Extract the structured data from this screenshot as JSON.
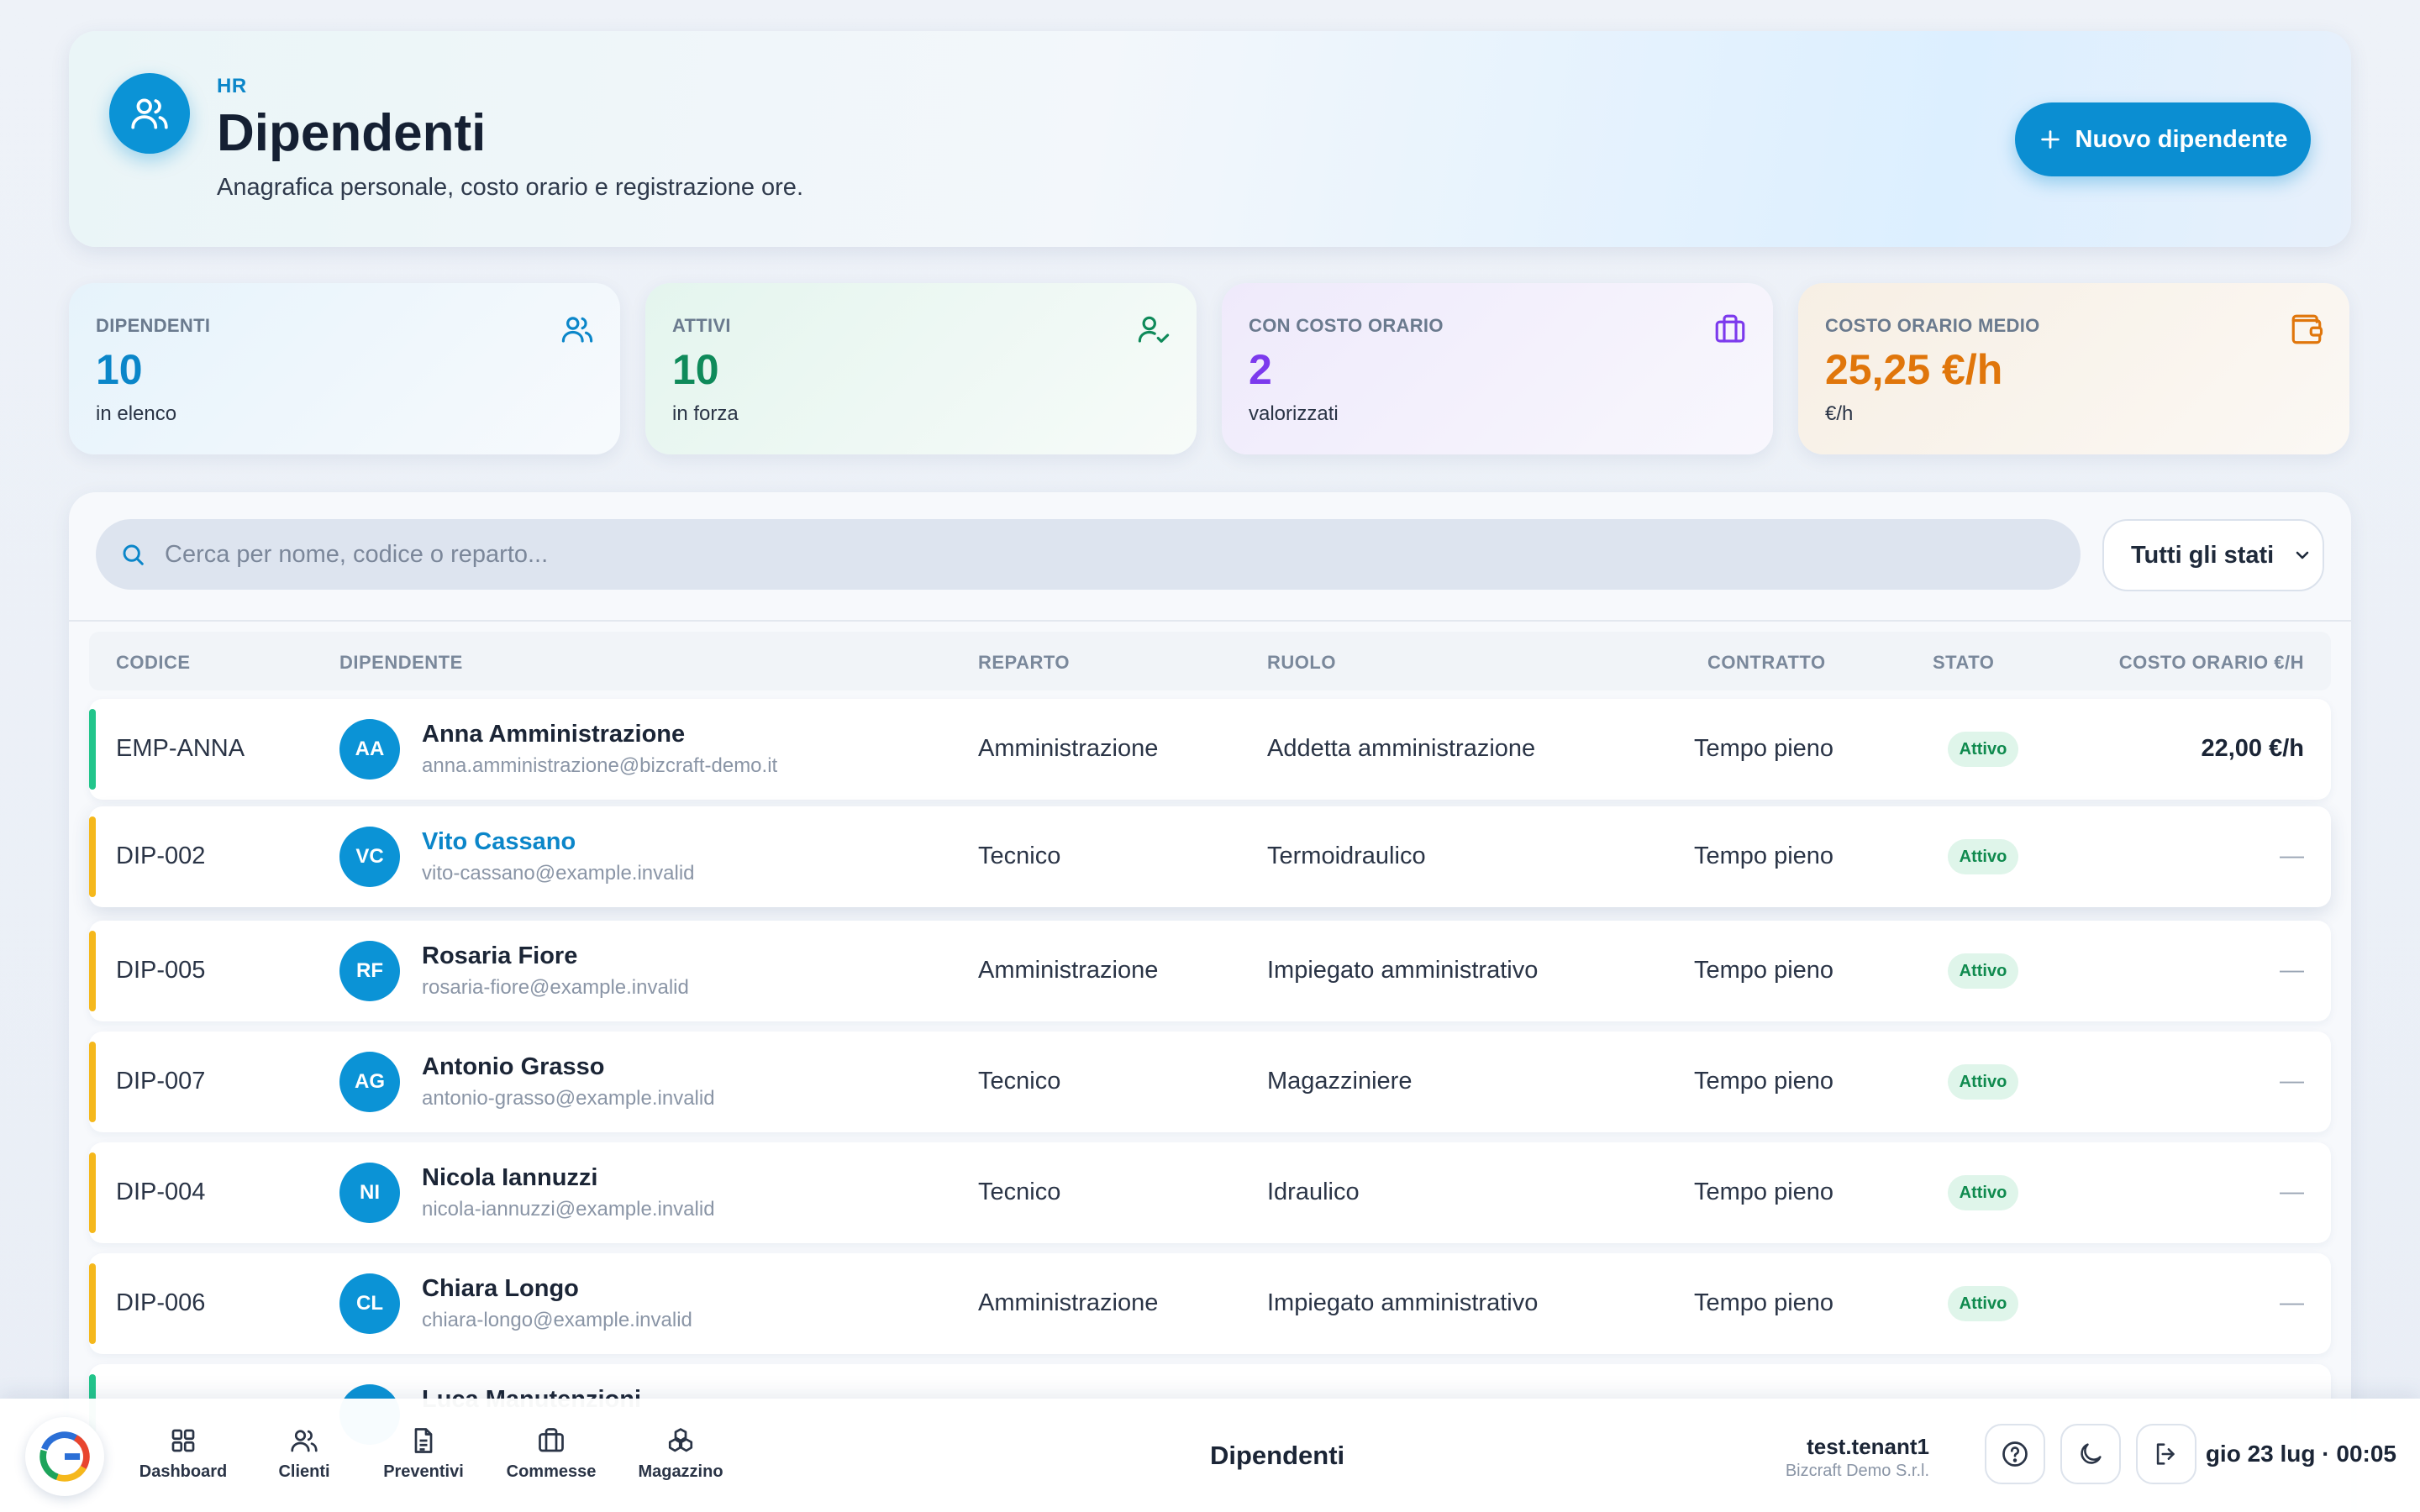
{
  "header": {
    "eyebrow": "HR",
    "title": "Dipendenti",
    "subtitle": "Anagrafica personale, costo orario e registrazione ore.",
    "new_button_label": "Nuovo dipendente"
  },
  "stats": [
    {
      "label": "DIPENDENTI",
      "value": "10",
      "sub": "in elenco",
      "color": "#0b86c9",
      "icon": "users-icon"
    },
    {
      "label": "ATTIVI",
      "value": "10",
      "sub": "in forza",
      "color": "#0f8a5a",
      "icon": "user-check-icon"
    },
    {
      "label": "CON COSTO ORARIO",
      "value": "2",
      "sub": "valorizzati",
      "color": "#7c3aed",
      "icon": "briefcase-icon"
    },
    {
      "label": "COSTO ORARIO MEDIO",
      "value": "25,25 €/h",
      "sub": "€/h",
      "color": "#e0760b",
      "icon": "wallet-icon"
    }
  ],
  "filters": {
    "search_placeholder": "Cerca per nome, codice o reparto...",
    "status_selected": "Tutti gli stati"
  },
  "table": {
    "columns": [
      "CODICE",
      "DIPENDENTE",
      "REPARTO",
      "RUOLO",
      "CONTRATTO",
      "STATO",
      "COSTO ORARIO €/H"
    ],
    "rows": [
      {
        "code": "EMP-ANNA",
        "initials": "AA",
        "name": "Anna Amministrazione",
        "email": "anna.amministrazione@bizcraft-demo.it",
        "department": "Amministrazione",
        "role": "Addetta amministrazione",
        "contract": "Tempo pieno",
        "status": "Attivo",
        "cost": "22,00 €/h",
        "accent": "#22c58b"
      },
      {
        "code": "DIP-002",
        "initials": "VC",
        "name": "Vito Cassano",
        "email": "vito-cassano@example.invalid",
        "department": "Tecnico",
        "role": "Termoidraulico",
        "contract": "Tempo pieno",
        "status": "Attivo",
        "cost": "—",
        "accent": "#f5b81c"
      },
      {
        "code": "DIP-005",
        "initials": "RF",
        "name": "Rosaria Fiore",
        "email": "rosaria-fiore@example.invalid",
        "department": "Amministrazione",
        "role": "Impiegato amministrativo",
        "contract": "Tempo pieno",
        "status": "Attivo",
        "cost": "—",
        "accent": "#f5b81c"
      },
      {
        "code": "DIP-007",
        "initials": "AG",
        "name": "Antonio Grasso",
        "email": "antonio-grasso@example.invalid",
        "department": "Tecnico",
        "role": "Magazziniere",
        "contract": "Tempo pieno",
        "status": "Attivo",
        "cost": "—",
        "accent": "#f5b81c"
      },
      {
        "code": "DIP-004",
        "initials": "NI",
        "name": "Nicola Iannuzzi",
        "email": "nicola-iannuzzi@example.invalid",
        "department": "Tecnico",
        "role": "Idraulico",
        "contract": "Tempo pieno",
        "status": "Attivo",
        "cost": "—",
        "accent": "#f5b81c"
      },
      {
        "code": "DIP-006",
        "initials": "CL",
        "name": "Chiara Longo",
        "email": "chiara-longo@example.invalid",
        "department": "Amministrazione",
        "role": "Impiegato amministrativo",
        "contract": "Tempo pieno",
        "status": "Attivo",
        "cost": "—",
        "accent": "#f5b81c"
      },
      {
        "code": "",
        "initials": "",
        "name": "Luca Manutenzioni",
        "email": "",
        "department": "",
        "role": "",
        "contract": "",
        "status": "",
        "cost": "",
        "accent": "#22c58b"
      }
    ]
  },
  "bottom_bar": {
    "nav": [
      {
        "label": "Dashboard",
        "icon": "dashboard-icon"
      },
      {
        "label": "Clienti",
        "icon": "users-icon"
      },
      {
        "label": "Preventivi",
        "icon": "document-icon"
      },
      {
        "label": "Commesse",
        "icon": "briefcase-icon"
      },
      {
        "label": "Magazzino",
        "icon": "boxes-icon"
      }
    ],
    "page_title": "Dipendenti",
    "user_name": "test.tenant1",
    "user_org": "Bizcraft Demo S.r.l.",
    "datetime": "gio 23 lug · 00:05"
  },
  "colors": {
    "brand": "#0b8ed2",
    "active_badge_bg": "#dff5ea",
    "active_badge_text": "#0f8a4e",
    "highlight_name": "#0b86c9"
  }
}
